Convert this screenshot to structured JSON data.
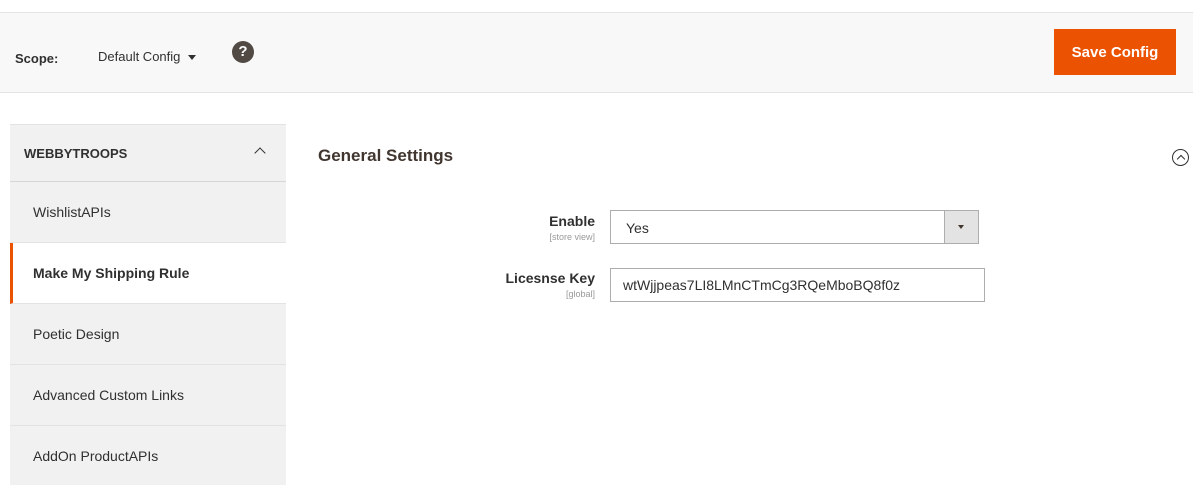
{
  "header": {
    "scope_label": "Scope:",
    "scope_value": "Default Config",
    "help_icon": "?",
    "save_label": "Save Config"
  },
  "sidebar": {
    "title": "WEBBYTROOPS",
    "items": [
      {
        "label": "WishlistAPIs",
        "active": false
      },
      {
        "label": "Make My Shipping Rule",
        "active": true
      },
      {
        "label": "Poetic Design",
        "active": false
      },
      {
        "label": "Advanced Custom Links",
        "active": false
      },
      {
        "label": "AddOn ProductAPIs",
        "active": false
      }
    ]
  },
  "section": {
    "title": "General Settings",
    "fields": {
      "enable": {
        "label": "Enable",
        "scope": "[store view]",
        "value": "Yes"
      },
      "license": {
        "label": "Licesnse Key",
        "scope": "[global]",
        "value": "wtWjjpeas7LI8LMnCTmCg3RQeMboBQ8f0z"
      }
    }
  },
  "colors": {
    "accent": "#eb5202",
    "text": "#303030",
    "sidebar_bg": "#f1f1f1",
    "scope_bar_bg": "#f8f8f8"
  },
  "icons": [
    "caret-down-icon",
    "help-icon",
    "chevron-up-icon",
    "collapse-circle-icon",
    "select-arrow-icon"
  ]
}
